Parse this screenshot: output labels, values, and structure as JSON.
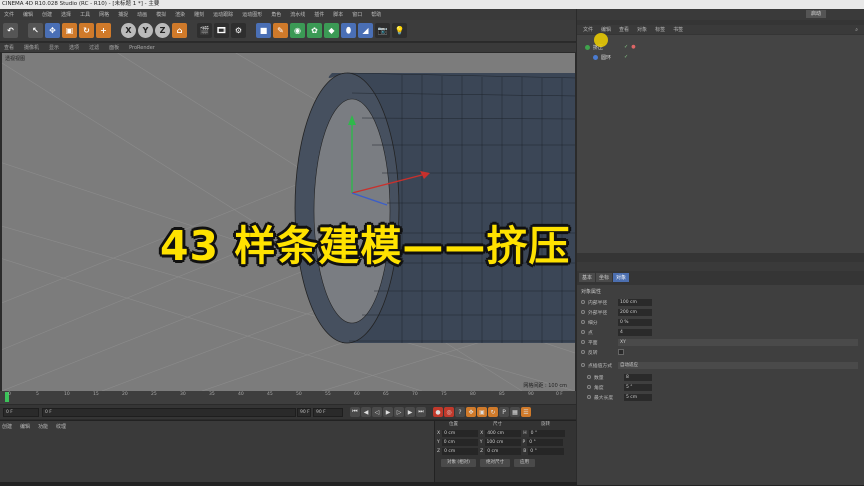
{
  "window": {
    "title": "CINEMA 4D R10.028 Studio (RC - R10) - [未标题 1 *] - 主要"
  },
  "menu": [
    "文件",
    "编辑",
    "创建",
    "选择",
    "工具",
    "网格",
    "捕捉",
    "动画",
    "模拟",
    "渲染",
    "雕刻",
    "运动跟踪",
    "运动图形",
    "角色",
    "流水线",
    "插件",
    "脚本",
    "窗口",
    "帮助"
  ],
  "toolbar": {
    "axis_x": "X",
    "axis_y": "Y",
    "axis_z": "Z"
  },
  "viewport": {
    "menu": [
      "查看",
      "摄像机",
      "显示",
      "选项",
      "过滤",
      "面板",
      "ProRender"
    ],
    "label": "透视视图",
    "grid_info": "网格间距 : 100 cm"
  },
  "timeline": {
    "ticks": [
      "0",
      "5",
      "10",
      "15",
      "20",
      "25",
      "30",
      "35",
      "40",
      "45",
      "50",
      "55",
      "60",
      "65",
      "70",
      "75",
      "80",
      "85",
      "90"
    ],
    "current_frame": "0 F",
    "start_field": "0 F",
    "range_field": "0 F",
    "end_field": "90 F",
    "end2_field": "90 F"
  },
  "materials": {
    "tabs": [
      "创建",
      "编辑",
      "功能",
      "纹理"
    ]
  },
  "coordinates": {
    "headers": [
      "位置",
      "尺寸",
      "旋转"
    ],
    "rows": [
      {
        "axis": "X",
        "pos": "0 cm",
        "size": "400 cm",
        "rot_label": "H",
        "rot": "0 °"
      },
      {
        "axis": "Y",
        "pos": "0 cm",
        "size": "100 cm",
        "rot_label": "P",
        "rot": "0 °"
      },
      {
        "axis": "Z",
        "pos": "0 cm",
        "size": "0 cm",
        "rot_label": "B",
        "rot": "0 °"
      }
    ],
    "mode": "对象 (相对)",
    "size_mode": "绝对尺寸",
    "apply": "应用"
  },
  "right_panel": {
    "layout_label": "启动",
    "object_menu": [
      "文件",
      "编辑",
      "查看",
      "对象",
      "标签",
      "书签"
    ],
    "objects": [
      {
        "name": "挤压"
      },
      {
        "name": "圆环"
      }
    ],
    "attr_tabs": [
      "基本",
      "坐标",
      "对象"
    ],
    "attr_section": "对象属性",
    "attrs": [
      {
        "label": "内部半径",
        "value": "100 cm"
      },
      {
        "label": "外部半径",
        "value": "200 cm"
      },
      {
        "label": "细分",
        "value": "0 %"
      },
      {
        "label": "点",
        "value": "4"
      }
    ],
    "plane_label": "平面",
    "plane_value": "XY",
    "reverse_label": "反转",
    "interp_label": "点插值方式",
    "interp_value": "自动适应",
    "sub_attrs": [
      {
        "label": "数量",
        "value": "8"
      },
      {
        "label": "角度",
        "value": "5 °"
      },
      {
        "label": "最大长度",
        "value": "5 cm"
      }
    ]
  },
  "overlay": {
    "title": "43 样条建模——挤压"
  },
  "colors": {
    "viewport_bg": "#7c7c7c",
    "overlay_text": "#ffe200",
    "tube": "#3b4656",
    "accent_blue": "#4c6fb0"
  }
}
